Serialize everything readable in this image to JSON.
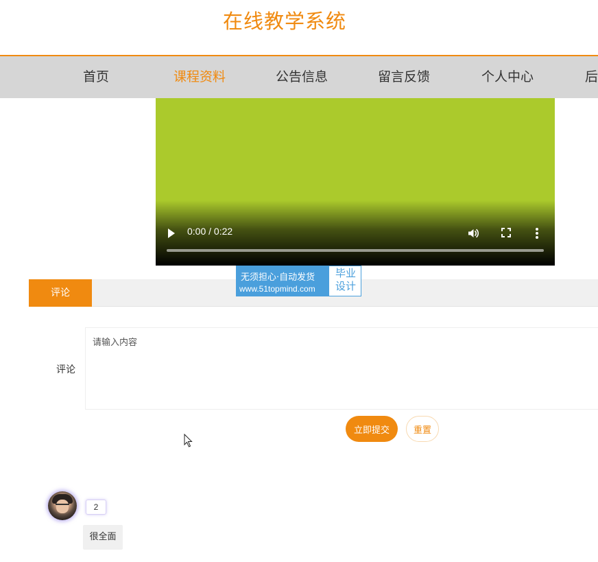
{
  "header": {
    "title": "在线教学系统"
  },
  "nav": {
    "items": [
      {
        "label": "首页",
        "active": false
      },
      {
        "label": "课程资料",
        "active": true
      },
      {
        "label": "公告信息",
        "active": false
      },
      {
        "label": "留言反馈",
        "active": false
      },
      {
        "label": "个人中心",
        "active": false
      },
      {
        "label": "后",
        "active": false
      }
    ]
  },
  "video": {
    "time": "0:00 / 0:22",
    "progress": 0,
    "icons": [
      "play-icon",
      "volume-icon",
      "fullscreen-icon",
      "more-options-icon"
    ]
  },
  "watermark": {
    "line1": "无须担心·自动发货",
    "line2": "www.51topmind.com",
    "side_line1": "毕业",
    "side_line2": "设计"
  },
  "tabs": {
    "active_label": "评论"
  },
  "comment_form": {
    "label": "评论",
    "placeholder": "请输入内容",
    "submit_label": "立即提交",
    "reset_label": "重置"
  },
  "comments": [
    {
      "username": "2",
      "text": "很全面"
    }
  ],
  "colors": {
    "accent": "#f08a10",
    "nav_bg": "#d6d6d6",
    "video_bg": "#abca2c",
    "watermark": "#4a9fdc"
  }
}
